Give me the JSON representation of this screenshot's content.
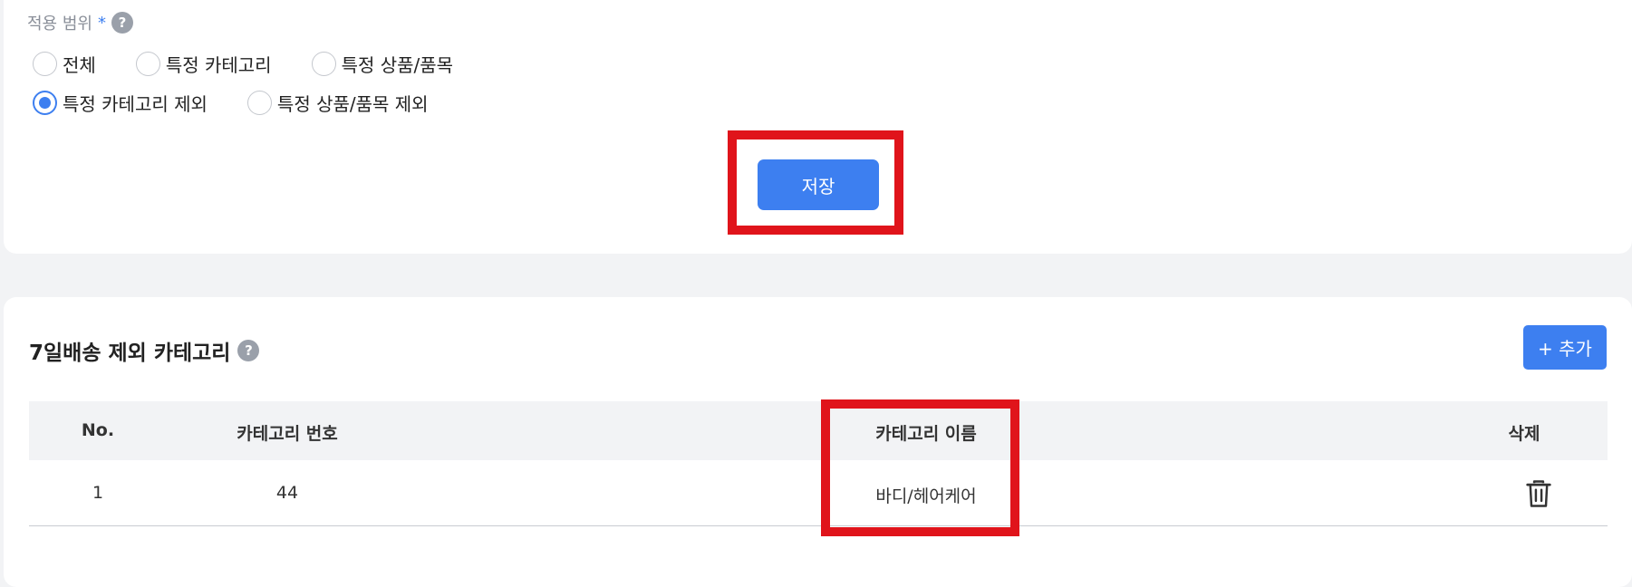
{
  "scope": {
    "label": "적용 범위",
    "required_mark": "*",
    "help_glyph": "?",
    "options_row1": [
      "전체",
      "특정 카테고리",
      "특정 상품/품목"
    ],
    "options_row2": [
      "특정 카테고리 제외",
      "특정 상품/품목 제외"
    ],
    "selected": "특정 카테고리 제외",
    "save_label": "저장"
  },
  "excluded": {
    "title": "7일배송 제외 카테고리",
    "help_glyph": "?",
    "add_label": "+ 추가",
    "columns": [
      "No.",
      "카테고리 번호",
      "카테고리 이름",
      "삭제"
    ],
    "rows": [
      {
        "no": "1",
        "category_id": "44",
        "category_name": "바디/헤어케어",
        "delete_icon": "trash-icon"
      }
    ]
  },
  "colors": {
    "accent": "#3d7ff0",
    "highlight": "#e0141b",
    "page_bg": "#f2f3f5"
  }
}
